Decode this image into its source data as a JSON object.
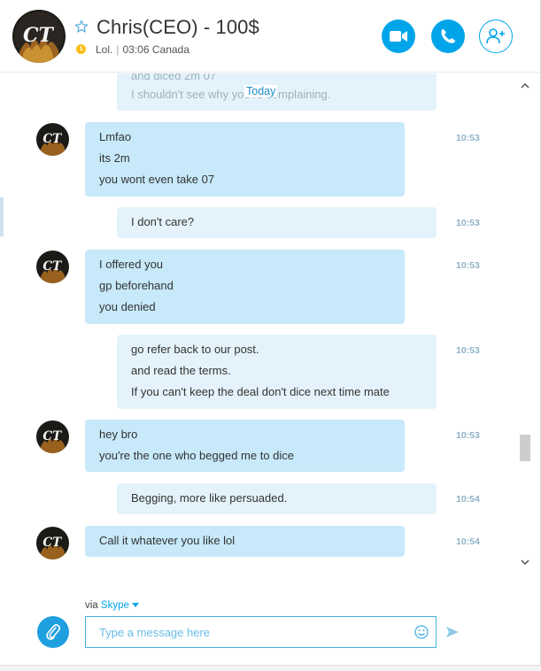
{
  "header": {
    "contact_name": "Chris(CEO) - 100$",
    "mood_text": "Lol.",
    "local_time": "03:06 Canada",
    "separator": "|"
  },
  "conversation": {
    "previous_lines": [
      "and diced 2m 07",
      "I shouldn't see why you're complaining."
    ],
    "date_divider": "Today",
    "messages": [
      {
        "direction": "in",
        "lines": [
          "Lmfao",
          "its 2m",
          "you wont even take 07"
        ],
        "time": "10:53"
      },
      {
        "direction": "out",
        "lines": [
          "I don't care?"
        ],
        "time": "10:53"
      },
      {
        "direction": "in",
        "lines": [
          "I offered you",
          "gp beforehand",
          "you denied"
        ],
        "time": "10:53"
      },
      {
        "direction": "out",
        "lines": [
          "go refer back to our post.",
          "and read the terms.",
          "If you can't keep the deal don't dice next time mate"
        ],
        "time": "10:53"
      },
      {
        "direction": "in",
        "lines": [
          "hey bro",
          "you're the one who begged me to dice"
        ],
        "time": "10:53"
      },
      {
        "direction": "out",
        "lines": [
          "Begging, more like persuaded."
        ],
        "time": "10:54"
      },
      {
        "direction": "in",
        "lines": [
          "Call it whatever you like lol"
        ],
        "time": "10:54"
      }
    ]
  },
  "composer": {
    "via_label": "via",
    "service": "Skype",
    "placeholder": "Type a message here",
    "value": ""
  },
  "icons": {
    "favorite": "star-outline-icon",
    "status": "away-clock-icon",
    "video": "video-camera-icon",
    "call": "phone-icon",
    "add_people": "add-person-icon",
    "attach": "paperclip-icon",
    "emoji": "smiley-icon",
    "send": "send-arrow-icon"
  },
  "colors": {
    "accent": "#00a5e9",
    "incoming_bubble": "#c7e9fa",
    "outgoing_bubble": "#e4f3fb",
    "status_away": "#fbbf1c",
    "timestamp": "#8fb3c6"
  }
}
